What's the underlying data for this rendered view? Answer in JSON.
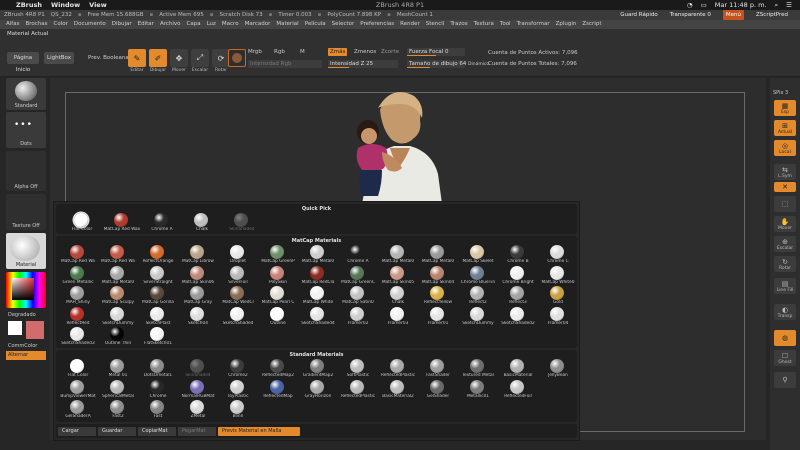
{
  "mac_menu": {
    "app": "ZBrush",
    "items": [
      "Window",
      "View"
    ],
    "window_title": "ZBrush 4R8 P1",
    "clock": "Mar 11:48 p. m."
  },
  "zbrush_status": {
    "version": "ZBrush 4R8 P1",
    "qs": "QS_232",
    "free_mem": "Free Mem 15.688GB",
    "active_mem": "Active Mem 695",
    "scratch": "Scratch Disk 73",
    "timer": "Timer 0.003",
    "polycount": "PolyCount 7.898 KP",
    "meshcount": "MeshCount 1",
    "quick_save": "Guard Rápido",
    "transparency": "Transparente 0",
    "menus": "Menú",
    "script": "ZScriptPred"
  },
  "main_menu": [
    "Alfas",
    "Brochas",
    "Color",
    "Documento",
    "Dibujar",
    "Editar",
    "Archivo",
    "Capa",
    "Luz",
    "Macro",
    "Marcador",
    "Material",
    "Película",
    "Selector",
    "Preferencias",
    "Render",
    "Stencil",
    "Trazos",
    "Textura",
    "Tool",
    "Transformar",
    "Zplugin",
    "Zscript"
  ],
  "toolbar": {
    "material_label": "Material Actual",
    "home_page": "Página Inicio",
    "lightbox": "LightBox",
    "booleans": "Prev. Booleana",
    "edit": "Editar",
    "draw": "Dibujar",
    "move": "Mover",
    "scale": "Escalar",
    "rotate": "Rotar",
    "mrgb": "Mrgb",
    "rgb": "Rgb",
    "m": "M",
    "rgb_intensity": "Intensidad Rgb",
    "zadd": "Zmás",
    "zsub": "Zmenos",
    "zcut": "Zcorte",
    "focal_shift": "Fuerza Focal 0",
    "draw_size": "Tamaño de dibujo 64",
    "z_intensity": "Intensidad Z 25",
    "dynamic": "Dinámico",
    "active_points": "Cuenta de Puntos Activos: 7,096",
    "total_points": "Cuenta de Puntos Totales: 7,096"
  },
  "left_panel": {
    "standard": "Standard",
    "dots": "Dots",
    "alpha_off": "Alpha Off",
    "texture_off": "Texture Off",
    "material": "Material",
    "gradient": "Degradado",
    "switch_color": "CommColor",
    "alternate": "Alternar"
  },
  "right_panel": [
    "SPix 3",
    "Esp",
    "Actual",
    "Local",
    "L.Sym",
    "Mover",
    "Escalar",
    "Rotar",
    "Line Fill",
    "Transp",
    "Ghost"
  ],
  "popup": {
    "quick_pick": {
      "title": "Quick Pick",
      "items": [
        {
          "name": "Flat Color",
          "color": "#ffffff",
          "selected": true
        },
        {
          "name": "MatCap Red Wax",
          "color": "#b03a2e"
        },
        {
          "name": "Chrome A",
          "color": "#2a2a2a"
        },
        {
          "name": "Chalk",
          "color": "#bdbdbd"
        },
        {
          "name": "SkinShade4",
          "color": "#8a8a8a",
          "dimmed": true
        }
      ]
    },
    "matcap": {
      "title": "MatCap Materials",
      "rows": [
        [
          {
            "name": "MatCap Red Wa",
            "color": "#b7493c"
          },
          {
            "name": "MatCap Red Wa",
            "color": "#c45c48"
          },
          {
            "name": "ReflectOrange",
            "color": "#d56a2a"
          },
          {
            "name": "MatCap Librow",
            "color": "#b9a48c"
          },
          {
            "name": "Droplet",
            "color": "#e8e8e8"
          },
          {
            "name": "MatCap GreenP",
            "color": "#6d8f6a"
          },
          {
            "name": "MatCap Metal0",
            "color": "#cfcfcf"
          },
          {
            "name": "Chrome A",
            "color": "#1e1e1e"
          },
          {
            "name": "MatCap Metal0",
            "color": "#b5b5b5"
          },
          {
            "name": "MatCap Metal0",
            "color": "#9a9a9a"
          },
          {
            "name": "MatCap Skelet",
            "color": "#d6c8a6"
          },
          {
            "name": "Chrome B",
            "color": "#3a3a3a"
          },
          {
            "name": "Chrome C",
            "color": "#dcdcdc"
          }
        ],
        [
          {
            "name": "Green Metallic",
            "color": "#4d7a4d"
          },
          {
            "name": "MatCap Metal0",
            "color": "#a8a8a8"
          },
          {
            "name": "SilverStraight",
            "color": "#c9c9c9"
          },
          {
            "name": "MatCap Skin06",
            "color": "#c08a78"
          },
          {
            "name": "SilverFoil",
            "color": "#bababa"
          },
          {
            "name": "PolySkin",
            "color": "#c8827a"
          },
          {
            "name": "MatCap RedCla",
            "color": "#8e2c24"
          },
          {
            "name": "MatCap GreenC",
            "color": "#587758"
          },
          {
            "name": "MatCap Skin05",
            "color": "#c99a86"
          },
          {
            "name": "MatCap Skin04",
            "color": "#b88570"
          },
          {
            "name": "Chrome BlueTin",
            "color": "#6f7f95"
          },
          {
            "name": "Chrome Bright",
            "color": "#f0f0f0"
          },
          {
            "name": "MatCap White0",
            "color": "#e8e8e8"
          }
        ],
        [
          {
            "name": "MAH_Shiny",
            "color": "#9e9e9e"
          },
          {
            "name": "MatCap Sculpy",
            "color": "#b98c6f"
          },
          {
            "name": "MatCap Gorilla",
            "color": "#5a4a3a"
          },
          {
            "name": "MatCap Gray",
            "color": "#9a9a9a"
          },
          {
            "name": "MatCap WedCl",
            "color": "#8a6e55"
          },
          {
            "name": "MatCap Pearl C",
            "color": "#e2dcd5"
          },
          {
            "name": "MatCap White",
            "color": "#f2f2f2"
          },
          {
            "name": "MatCap Satin0",
            "color": "#c2c2c2"
          },
          {
            "name": "Chalk",
            "color": "#d0d0d0"
          },
          {
            "name": "ReflectYellow",
            "color": "#d9b24a"
          },
          {
            "name": "Reflect2",
            "color": "#b3b3b3"
          },
          {
            "name": "Reflect3",
            "color": "#a4a4a4"
          },
          {
            "name": "Gold",
            "color": "#caa242"
          }
        ],
        [
          {
            "name": "ReflectRed",
            "color": "#b5322a"
          },
          {
            "name": "SketchDummy",
            "color": "#d8d8d8"
          },
          {
            "name": "SketchPlast",
            "color": "#eaeaea"
          },
          {
            "name": "Sketch04",
            "color": "#dedede"
          },
          {
            "name": "SketchShaded",
            "color": "#f0f0f0"
          },
          {
            "name": "Outline",
            "color": "#ffffff"
          },
          {
            "name": "SketchShaded4",
            "color": "#e4e4e4"
          },
          {
            "name": "Framer02",
            "color": "#cfcfcf"
          },
          {
            "name": "Framer03",
            "color": "#f2f2f2"
          },
          {
            "name": "Framer01",
            "color": "#e6e6e6"
          },
          {
            "name": "SketchDummy",
            "color": "#dadada"
          },
          {
            "name": "SketchShaded2",
            "color": "#ececec"
          },
          {
            "name": "Framer04",
            "color": "#e0e0e0"
          }
        ],
        [
          {
            "name": "SketchShaded3",
            "color": "#e8e8e8"
          },
          {
            "name": "Outline Thin",
            "color": "#050505"
          },
          {
            "name": "FlatSketch01",
            "color": "#f5f5f5"
          }
        ]
      ]
    },
    "standard": {
      "title": "Standard Materials",
      "rows": [
        [
          {
            "name": "Flat Color",
            "color": "#ffffff"
          },
          {
            "name": "Metal 01",
            "color": "#9b9b9b"
          },
          {
            "name": "DotsOmetal1",
            "color": "#8c8c8c"
          },
          {
            "name": "SkinShade4",
            "color": "#8a8a8a",
            "dimmed": true
          },
          {
            "name": "Chrome2",
            "color": "#3c3c3c"
          },
          {
            "name": "ReflectedMap2",
            "color": "#4a4a4a"
          },
          {
            "name": "GradientMap2",
            "color": "#7f7f7f"
          },
          {
            "name": "SoftPlastic",
            "color": "#bdbdbd"
          },
          {
            "name": "ReflectedPlastic",
            "color": "#a8a8a8"
          },
          {
            "name": "FastShader",
            "color": "#9c9c9c"
          },
          {
            "name": "Textured Metal",
            "color": "#6e6e6e"
          },
          {
            "name": "BasicMaterial",
            "color": "#b0b0b0"
          },
          {
            "name": "JellyBean",
            "color": "#8e8e8e"
          }
        ],
        [
          {
            "name": "BumpViewerMat",
            "color": "#9e9e9e"
          },
          {
            "name": "SphericalMetal",
            "color": "#b6b6b6"
          },
          {
            "name": "Chrome",
            "color": "#272727"
          },
          {
            "name": "NormalRGBMat",
            "color": "#7a6fb8"
          },
          {
            "name": "ToyPlastic",
            "color": "#cfcfcf"
          },
          {
            "name": "ReflectedMap",
            "color": "#4a64a8"
          },
          {
            "name": "GrayHorizon",
            "color": "#a8a8a8"
          },
          {
            "name": "ReflectedPlastic",
            "color": "#b8b8b8"
          },
          {
            "name": "BasicMaterial2",
            "color": "#bcbcbc"
          },
          {
            "name": "GelShader",
            "color": "#6a6a6a"
          },
          {
            "name": "Metallic01",
            "color": "#7c7c7c"
          },
          {
            "name": "ReflectedFoil",
            "color": "#c6c6c6"
          }
        ],
        [
          {
            "name": "GelShaderA",
            "color": "#9a9a9a"
          },
          {
            "name": "Fast2",
            "color": "#8e8e8e"
          },
          {
            "name": "Fast",
            "color": "#858585"
          },
          {
            "name": "ZMetal",
            "color": "#d8d8d8"
          },
          {
            "name": "Blinn",
            "color": "#cacaca"
          }
        ]
      ]
    },
    "buttons": {
      "load": "Cargar",
      "save": "Guardar",
      "copy": "CopiarMat",
      "paste": "PegarMat",
      "preview": "Previs Material en Malla"
    }
  }
}
